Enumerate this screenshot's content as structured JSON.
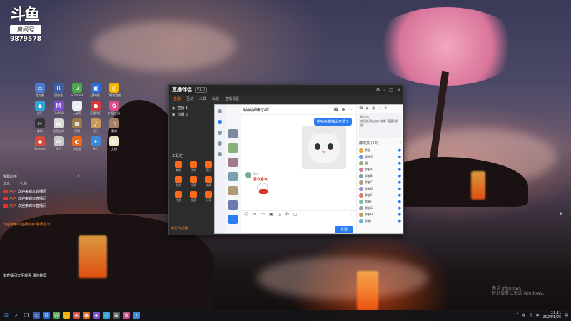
{
  "douyu": {
    "logo": "斗鱼",
    "tag": "房间号",
    "room_number": "9879578"
  },
  "desktop_icons": [
    {
      "label": "此电脑",
      "icon": "pc-icon",
      "color": "#4a7bd0",
      "glyph": "▭"
    },
    {
      "label": "回收站",
      "icon": "recycle-bin-icon",
      "color": "#3d5fa0",
      "glyph": "R"
    },
    {
      "label": "uTorrent",
      "icon": "utorrent-icon",
      "color": "#4aa84a",
      "glyph": "μ"
    },
    {
      "label": "此电脑",
      "icon": "computer-icon",
      "color": "#2d6bd8",
      "glyph": "▣"
    },
    {
      "label": "QQ浏览器",
      "icon": "qq-browser-icon",
      "color": "#f4b400",
      "glyph": "◎"
    },
    {
      "label": "虎牙",
      "icon": "app-icon",
      "color": "#30a6d8",
      "glyph": "◆"
    },
    {
      "label": "TeeMail",
      "icon": "mail-icon",
      "color": "#7b4fd0",
      "glyph": "M"
    },
    {
      "label": "云桌面",
      "icon": "cloud-icon",
      "color": "#e8eef6",
      "glyph": "☁"
    },
    {
      "label": "直播伴侣",
      "icon": "live-icon",
      "color": "#d83838",
      "glyph": "●"
    },
    {
      "label": "扩展工具",
      "icon": "tools-icon",
      "color": "#e04a8a",
      "glyph": "✿"
    },
    {
      "label": "剪映",
      "icon": "scissors-icon",
      "color": "#333333",
      "glyph": "✂"
    },
    {
      "label": "截图工具",
      "icon": "snip-icon",
      "color": "#d8d8d8",
      "glyph": "▤"
    },
    {
      "label": "视频",
      "icon": "video-icon",
      "color": "#9a7a4a",
      "glyph": "▦"
    },
    {
      "label": "音乐",
      "icon": "music-icon",
      "color": "#c89a5a",
      "glyph": "♪"
    },
    {
      "label": "素材",
      "icon": "folder-icon",
      "color": "#a08060",
      "glyph": "▯"
    },
    {
      "label": "Chrome",
      "icon": "chrome-icon",
      "color": "#d84a3a",
      "glyph": "◉"
    },
    {
      "label": "WPS",
      "icon": "wps-icon",
      "color": "#c8c8c8",
      "glyph": "W"
    },
    {
      "label": "浏览器",
      "icon": "browser-icon",
      "color": "#e86a1a",
      "glyph": "◐"
    },
    {
      "label": "Fish",
      "icon": "fish-icon",
      "color": "#3a8ad8",
      "glyph": "✦"
    },
    {
      "label": "文档",
      "icon": "document-icon",
      "color": "#efe4c4",
      "glyph": "▤"
    }
  ],
  "chat_overlay": {
    "title": "弹幕助手",
    "close": "×",
    "tabs": [
      "消息",
      "礼物"
    ],
    "messages": [
      {
        "name": "用户",
        "text": "欢迎来到本直播间"
      },
      {
        "name": "用户",
        "text": "欢迎来到本直播间"
      },
      {
        "name": "用户",
        "text": "欢迎来到本直播间"
      }
    ]
  },
  "notice_text": "欢迎使用本直播助手 弹幕显示",
  "notice_bottom": "本直播间文明观看 请勿刷屏",
  "qq": {
    "brand": "直播伴侣",
    "version": "v1.0",
    "tabs": [
      "直播",
      "互动",
      "工具",
      "私信",
      "直播设置"
    ],
    "rows": [
      "直播 1",
      "直播 2"
    ],
    "tools_title": "工具栏",
    "tools": [
      "美颜",
      "特效",
      "音乐",
      "贴纸",
      "投票",
      "抽奖",
      "任务",
      "连麦",
      "分享"
    ],
    "footer": "点击开始直播"
  },
  "chat_window": {
    "group_name": "喵喵猫咪小群",
    "my_message": "哈哈哈猫猫太可爱了",
    "sender_name": "群友",
    "sticker_text": "喜欢喜欢",
    "send_label": "发送",
    "side_notice": "群公告\n欢迎新朋友加入本群 请遵守群规",
    "members_title": "群成员 (52)",
    "members": [
      "群主",
      "管理员",
      "猫",
      "群友A",
      "群友B",
      "群友C",
      "群友D",
      "群友E",
      "群友F",
      "群友G",
      "群友H",
      "群友I"
    ]
  },
  "taskbar": {
    "clock_time": "19:11",
    "clock_date": "2024/1/25",
    "lang": "中"
  },
  "watermark": {
    "line1": "激活 Windows",
    "line2": "转到设置以激活 Windows。"
  }
}
